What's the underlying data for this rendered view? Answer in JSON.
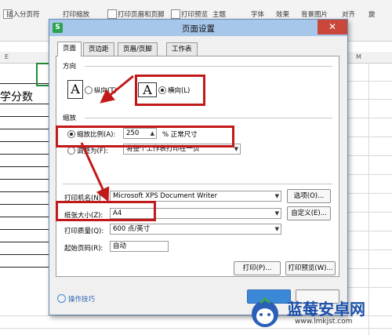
{
  "ribbon": {
    "items": [
      "插入分页符",
      "打印缩放",
      "打印页眉和页脚",
      "打印预览",
      "主题",
      "字体",
      "效果",
      "背景图片",
      "对齐",
      "旋"
    ]
  },
  "sheet": {
    "column_e": "E",
    "column_m": "M",
    "cell_text": "学分数"
  },
  "dialog": {
    "title": "页面设置",
    "app_icon": "S",
    "close": "✕",
    "tabs": [
      "页面",
      "页边距",
      "页眉/页脚",
      "工作表"
    ],
    "orientation": {
      "section": "方向",
      "portrait_icon": "A",
      "portrait_label": "纵向(T)",
      "landscape_icon": "A",
      "landscape_label": "横向(L)",
      "selected": "landscape"
    },
    "scaling": {
      "section": "缩放",
      "scale_label": "缩放比例(A):",
      "scale_value": "250",
      "scale_unit": "% 正常尺寸",
      "fit_label": "调整为(F):",
      "fit_value": "将整个工作表打印在一页",
      "selected": "scale"
    },
    "printer_name_label": "打印机名(N)",
    "printer_name_value": "Microsoft XPS Document Writer",
    "options_button": "选项(O)...",
    "paper_size_label": "纸张大小(Z):",
    "paper_size_value": "A4",
    "custom_button": "自定义(E)...",
    "print_quality_label": "打印质量(Q):",
    "print_quality_value": "600 点/英寸",
    "first_page_label": "起始页码(R):",
    "first_page_value": "自动",
    "print_button": "打印(P)...",
    "preview_button": "打印预览(W)...",
    "tips_link": "操作技巧"
  },
  "watermark": {
    "brand": "蓝莓安卓网",
    "url": "www.lmkjst.com"
  },
  "colors": {
    "titlebar": "#a7c7ea",
    "highlight_box": "#c21a1a",
    "close_button": "#c9483b",
    "watermark_text": "#1a4fa8"
  }
}
